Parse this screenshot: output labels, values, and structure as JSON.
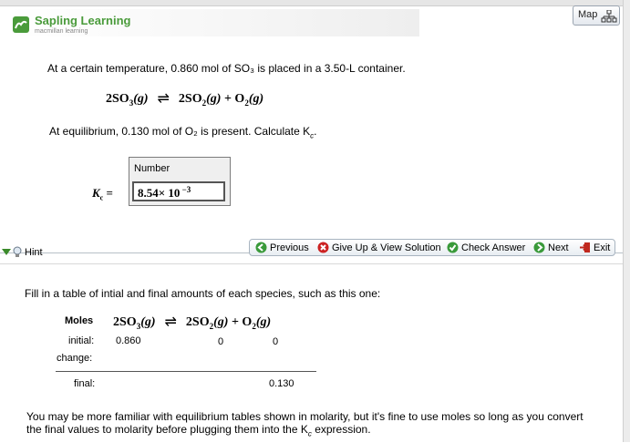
{
  "header": {
    "brand_name": "Sapling Learning",
    "brand_sub": "macmillan learning",
    "map_label": "Map"
  },
  "question": {
    "intro": "At a certain temperature, 0.860 mol of SO₃ is placed in a 3.50-L container.",
    "equilibrium": "At equilibrium, 0.130 mol of O₂ is present. Calculate K",
    "kc_sub": "c",
    "period": ".",
    "kc_label": "K",
    "kc_label_sub": "c",
    "equals": " =",
    "number_label": "Number",
    "answer_mantissa": "8.54× 10",
    "answer_exponent": " −3"
  },
  "equation": {
    "left": "2SO",
    "left_sub": "3",
    "phase": "(g)",
    "right1": "2SO",
    "right1_sub": "2",
    "plus": " + ",
    "right2": "O",
    "right2_sub": "2"
  },
  "toolbar": {
    "hint": "Hint",
    "previous": "Previous",
    "give_up": "Give Up & View Solution",
    "check": "Check Answer",
    "next": "Next",
    "exit": "Exit"
  },
  "hint": {
    "intro": "Fill in a table of intial and final amounts of each species, such as this one:",
    "moles_header": "Moles",
    "rows": {
      "initial_label": "initial:",
      "initial_so3": "0.860",
      "initial_so2": "0",
      "initial_o2": "0",
      "change_label": "change:",
      "final_label": "final:",
      "final_o2": "0.130"
    },
    "note_a": "You may be more familiar with equilibrium tables shown in molarity, but it's fine to use moles so long as you convert the final values to molarity before plugging them into the K",
    "note_sub": "c",
    "note_b": " expression."
  },
  "colors": {
    "brand_green": "#4a9b3b",
    "nav_green": "#3a9a3a",
    "give_up_red": "#cc2222",
    "exit_red": "#c0281e"
  }
}
